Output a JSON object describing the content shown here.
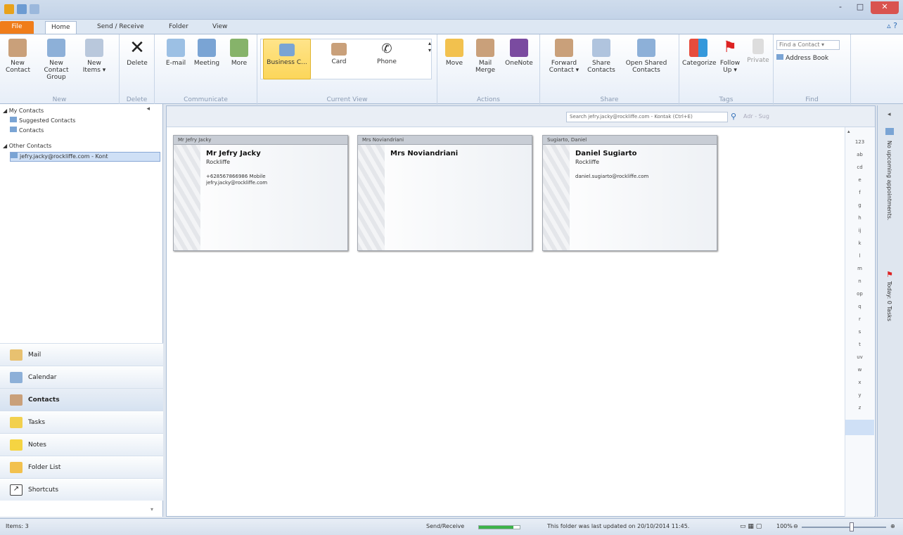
{
  "window": {
    "minimize": "-",
    "maximize": "□",
    "close": "✕"
  },
  "tabs": [
    "File",
    "Home",
    "Send / Receive",
    "Folder",
    "View"
  ],
  "ribbon": {
    "new": {
      "name": "New",
      "buttons": [
        "New Contact",
        "New Contact Group",
        "New Items ▾"
      ]
    },
    "delete": {
      "name": "Delete",
      "buttons": [
        "Delete"
      ]
    },
    "communicate": {
      "name": "Communicate",
      "buttons": [
        "E-mail",
        "Meeting",
        "More"
      ]
    },
    "current_view": {
      "name": "Current View",
      "buttons": [
        "Business C...",
        "Card",
        "Phone"
      ]
    },
    "actions": {
      "name": "Actions",
      "buttons": [
        "Move",
        "Mail Merge",
        "OneNote"
      ]
    },
    "share": {
      "name": "Share",
      "buttons": [
        "Forward Contact ▾",
        "Share Contacts",
        "Open Shared Contacts"
      ]
    },
    "tags": {
      "name": "Tags",
      "buttons": [
        "Categorize",
        "Follow Up ▾",
        "Private"
      ]
    },
    "find": {
      "name": "Find",
      "find_contact": "Find a Contact ▾",
      "address_book": "Address Book"
    }
  },
  "navtree": {
    "my_contacts": "◢ My Contacts",
    "suggested": "Suggested Contacts",
    "contacts": "Contacts",
    "other_contacts": "◢ Other Contacts",
    "selected": "jefry.jacky@rockliffe.com - Kont"
  },
  "navbuttons": [
    "Mail",
    "Calendar",
    "Contacts",
    "Tasks",
    "Notes",
    "Folder List",
    "Shortcuts"
  ],
  "search": {
    "placeholder": "Search jefry.jacky@rockliffe.com - Kontak (Ctrl+E)",
    "addr": "Adr - Sug"
  },
  "cards": [
    {
      "header": "Mr Jefry Jacky",
      "name": "Mr Jefry Jacky",
      "company": "Rockliffe",
      "phone": "+628567866986 Mobile",
      "email": "jefry.jacky@rockliffe.com"
    },
    {
      "header": "Mrs Noviandriani",
      "name": "Mrs Noviandriani",
      "company": "",
      "phone": "",
      "email": ""
    },
    {
      "header": "Sugiarto, Daniel",
      "name": "Daniel Sugiarto",
      "company": "Rockliffe",
      "phone": "",
      "email": "daniel.sugiarto@rockliffe.com"
    }
  ],
  "alphabet": [
    "123",
    "ab",
    "cd",
    "e",
    "f",
    "g",
    "h",
    "ij",
    "k",
    "l",
    "m",
    "n",
    "op",
    "q",
    "r",
    "s",
    "t",
    "uv",
    "w",
    "x",
    "y",
    "z"
  ],
  "todo": {
    "appointments": "No upcoming appointments.",
    "tasks": "Today: 0 Tasks"
  },
  "status": {
    "items": "Items: 3",
    "sendreceive": "Send/Receive",
    "sync_progress": 0.85,
    "updated": "This folder was last updated on 20/10/2014 11:45.",
    "zoom": "100%"
  }
}
